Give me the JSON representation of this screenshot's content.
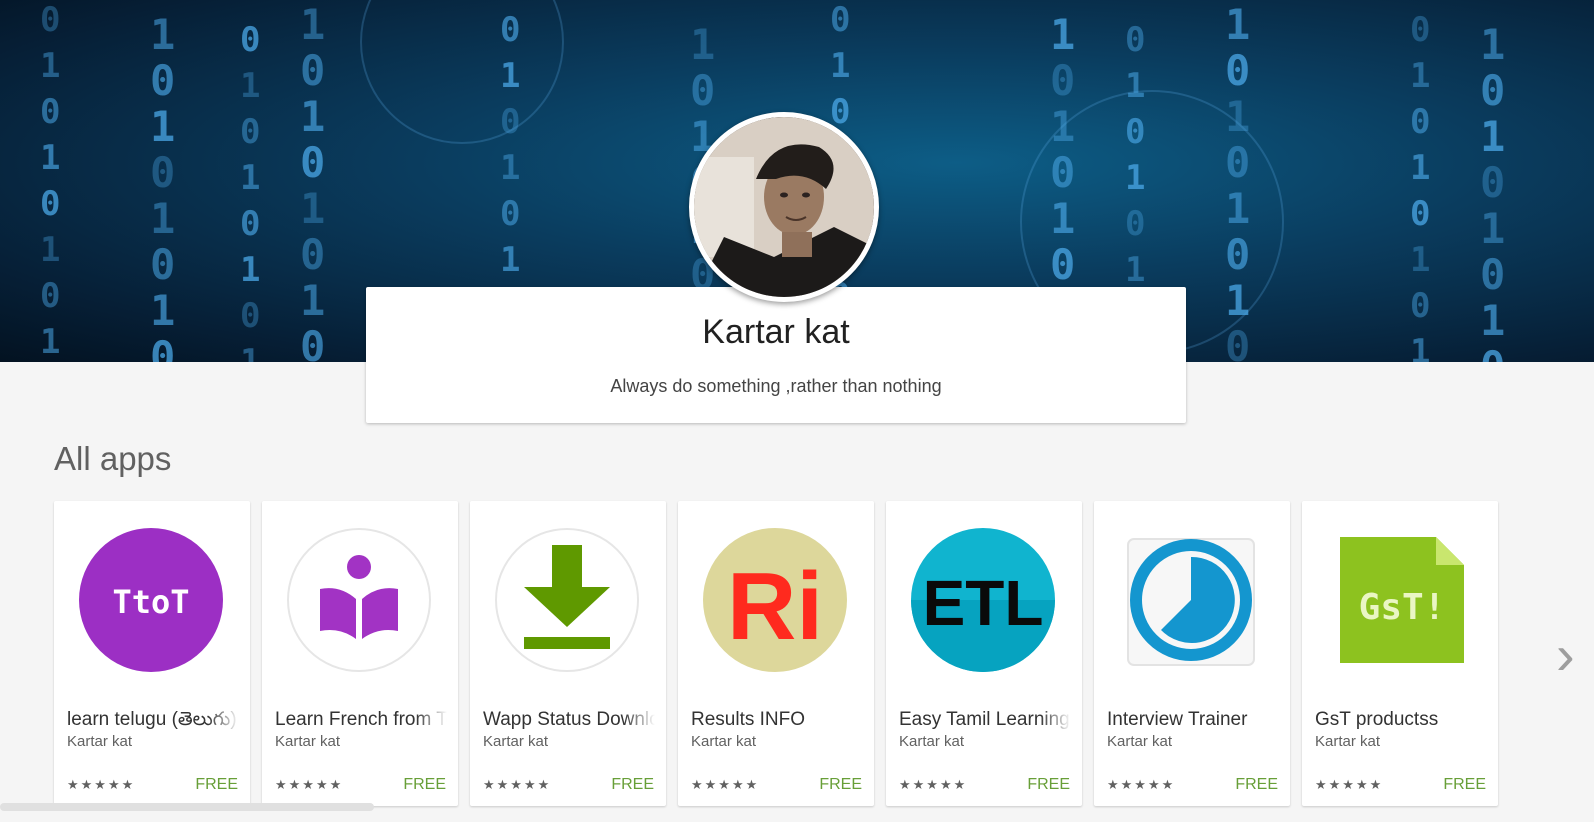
{
  "profile": {
    "name": "Kartar kat",
    "tagline": "Always do something ,rather than nothing"
  },
  "section": {
    "title": "All apps"
  },
  "apps": [
    {
      "title": "learn telugu (తెలుగు)",
      "developer": "Kartar kat",
      "price": "FREE",
      "rating": 5,
      "icon": "ttot-icon",
      "color": "#9c2fc4"
    },
    {
      "title": "Learn French from Telugu",
      "developer": "Kartar kat",
      "price": "FREE",
      "rating": 5,
      "icon": "book-reader-icon",
      "color": "#a233c4"
    },
    {
      "title": "Wapp Status Downloader",
      "developer": "Kartar kat",
      "price": "FREE",
      "rating": 5,
      "icon": "download-arrow-icon",
      "color": "#5f9900"
    },
    {
      "title": "Results INFO",
      "developer": "Kartar kat",
      "price": "FREE",
      "rating": 5,
      "icon": "ri-logo-icon",
      "color": "#ff2a1e"
    },
    {
      "title": "Easy Tamil Learning",
      "developer": "Kartar kat",
      "price": "FREE",
      "rating": 5,
      "icon": "etl-logo-icon",
      "color": "#10b4cf"
    },
    {
      "title": "Interview Trainer",
      "developer": "Kartar kat",
      "price": "FREE",
      "rating": 5,
      "icon": "timer-icon",
      "color": "#1496cf"
    },
    {
      "title": "GsT productss",
      "developer": "Kartar kat",
      "price": "FREE",
      "rating": 5,
      "icon": "gst-file-icon",
      "color": "#8dc21f"
    }
  ],
  "icon_text": {
    "ttot": "TtoT",
    "ri": "Ri",
    "etl": "ETL",
    "gst": "GsT!"
  }
}
